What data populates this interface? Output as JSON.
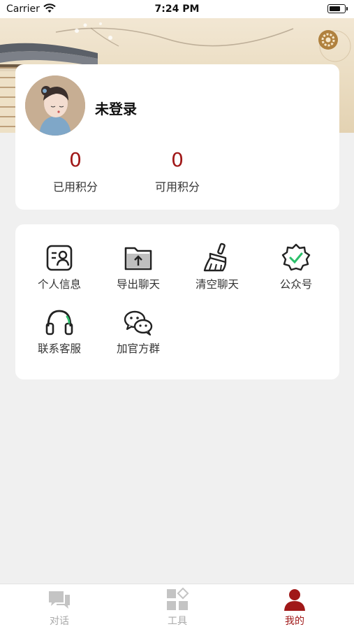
{
  "status_bar": {
    "carrier": "Carrier",
    "time": "7:24 PM"
  },
  "profile": {
    "username": "未登录",
    "stats": [
      {
        "value": "0",
        "label": "已用积分"
      },
      {
        "value": "0",
        "label": "可用积分"
      }
    ]
  },
  "menu": {
    "items": [
      {
        "label": "个人信息",
        "icon": "id-card-icon"
      },
      {
        "label": "导出聊天",
        "icon": "folder-export-icon"
      },
      {
        "label": "清空聊天",
        "icon": "broom-icon"
      },
      {
        "label": "公众号",
        "icon": "verified-badge-icon"
      },
      {
        "label": "联系客服",
        "icon": "headset-icon"
      },
      {
        "label": "加官方群",
        "icon": "wechat-icon"
      }
    ]
  },
  "tab_bar": {
    "tabs": [
      {
        "label": "对话",
        "icon": "chat-icon",
        "active": false
      },
      {
        "label": "工具",
        "icon": "tools-grid-icon",
        "active": false
      },
      {
        "label": "我的",
        "icon": "user-icon",
        "active": true
      }
    ]
  },
  "colors": {
    "accent": "#a01818",
    "inactive": "#aaaaaa",
    "background": "#f0f0f0"
  }
}
